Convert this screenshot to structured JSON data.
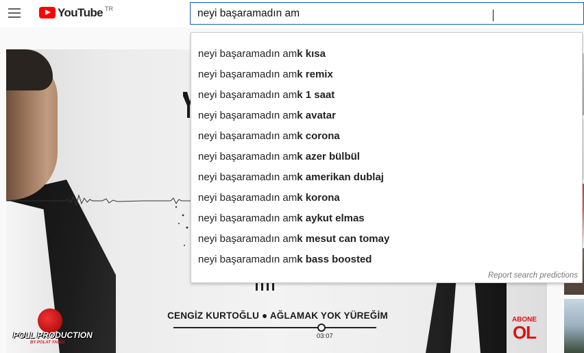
{
  "header": {
    "logo_text": "YouTube",
    "country_code": "TR",
    "search_value": "neyi başaramadın am"
  },
  "suggestions": {
    "prefix": "neyi başaramadın am",
    "items": [
      {
        "completion": "k kısa"
      },
      {
        "completion": "k remix"
      },
      {
        "completion": "k 1 saat"
      },
      {
        "completion": "k avatar"
      },
      {
        "completion": "k corona"
      },
      {
        "completion": "k azer bülbül"
      },
      {
        "completion": "k amerikan dublaj"
      },
      {
        "completion": "k korona"
      },
      {
        "completion": "k aykut elmas"
      },
      {
        "completion": "k mesut can tomay"
      },
      {
        "completion": "k bass boosted"
      }
    ],
    "report_label": "Report search predictions"
  },
  "video": {
    "title": "CENGİZ KURTOĞLU ● AĞLAMAK YOK YÜREĞİM",
    "timestamp": "03:07",
    "progress": 0.73,
    "channel_logo_text": "POLL PRODUCTION",
    "channel_logo_sub": "BY POLAT YAĞCI",
    "subscribe_top": "ABONE",
    "subscribe_bottom": "OL"
  },
  "colors": {
    "brand_red": "#ff0000",
    "search_border": "#1c62b9"
  }
}
